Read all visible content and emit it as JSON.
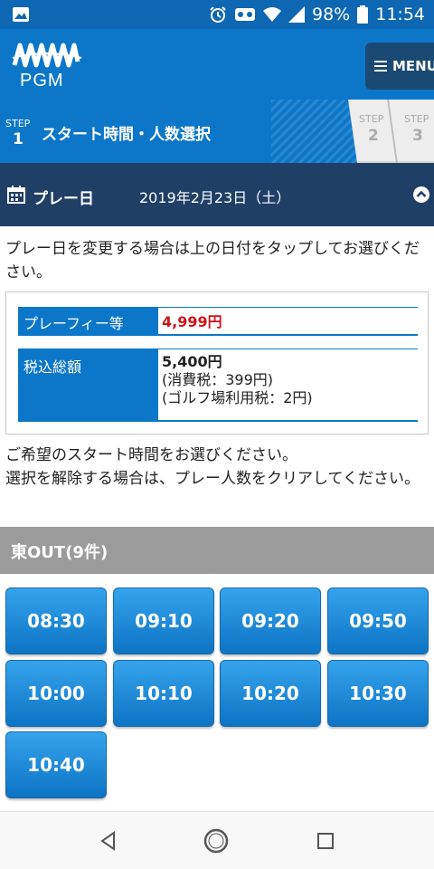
{
  "status_bar": {
    "battery": "98%",
    "time": "11:54"
  },
  "header": {
    "logo_text": "PGM",
    "menu_label": "MENU"
  },
  "steps": {
    "current": {
      "label": "STEP",
      "number": "1",
      "title": "スタート時間・人数選択"
    },
    "step2": {
      "label": "STEP",
      "number": "2"
    },
    "step3": {
      "label": "STEP",
      "number": "3"
    }
  },
  "play_date": {
    "label": "プレー日",
    "value": "2019年2月23日（土）"
  },
  "note_change_date": "プレー日を変更する場合は上の日付をタップしてお選びください。",
  "price": {
    "fee_label": "プレーフィー等",
    "fee_value": "4,999円",
    "total_label": "税込総額",
    "total_value": "5,400円",
    "consumption_tax": "(消費税：399円)",
    "golf_tax": "(ゴルフ場利用税：2円)"
  },
  "note_select": "ご希望のスタート時間をお選びください。\n選択を解除する場合は、プレー人数をクリアしてください。",
  "section_title": "東OUT(9件)",
  "times": [
    "08:30",
    "09:10",
    "09:20",
    "09:50",
    "10:00",
    "10:10",
    "10:20",
    "10:30",
    "10:40"
  ],
  "colors": {
    "primary": "#0c77c9",
    "dark_navy": "#1f3f66",
    "price_red": "#d0121b"
  }
}
